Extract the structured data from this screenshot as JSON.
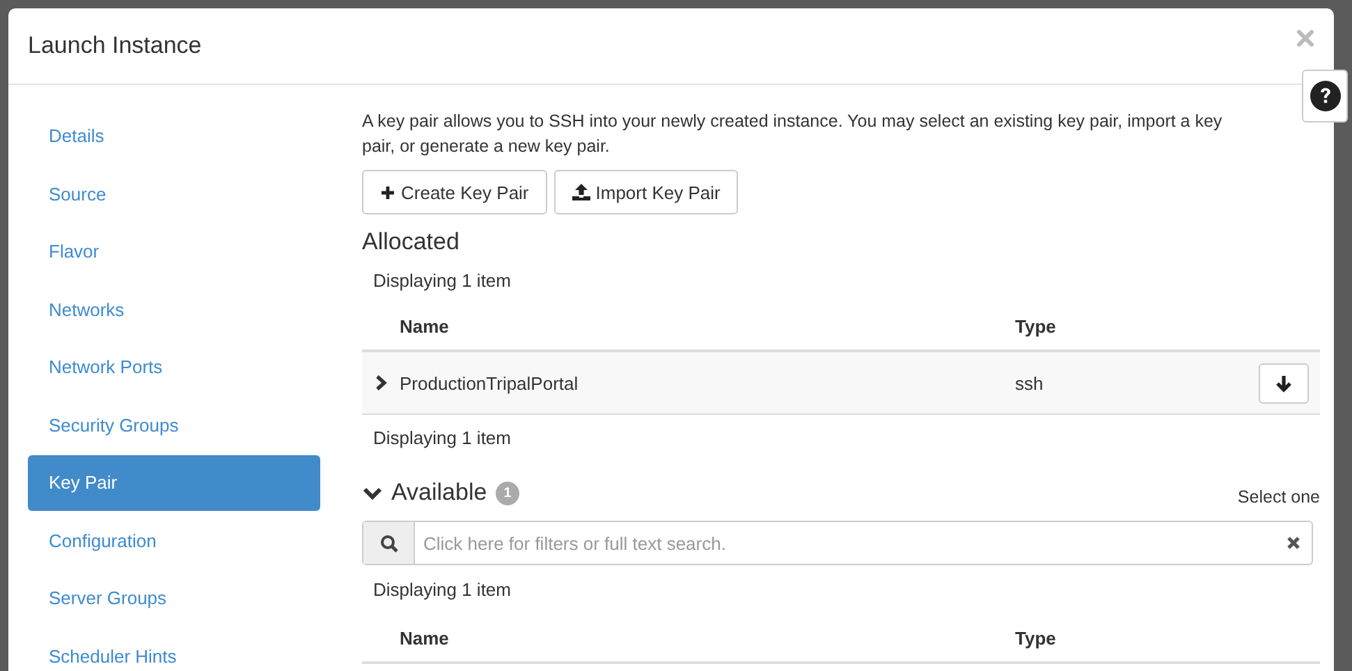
{
  "modal": {
    "title": "Launch Instance"
  },
  "sidebar": {
    "items": [
      {
        "label": "Details",
        "selected": false
      },
      {
        "label": "Source",
        "selected": false
      },
      {
        "label": "Flavor",
        "selected": false
      },
      {
        "label": "Networks",
        "selected": false
      },
      {
        "label": "Network Ports",
        "selected": false
      },
      {
        "label": "Security Groups",
        "selected": false
      },
      {
        "label": "Key Pair",
        "selected": true
      },
      {
        "label": "Configuration",
        "selected": false
      },
      {
        "label": "Server Groups",
        "selected": false
      },
      {
        "label": "Scheduler Hints",
        "selected": false
      }
    ]
  },
  "content": {
    "description": "A key pair allows you to SSH into your newly created instance. You may select an existing key pair, import a key pair, or generate a new key pair.",
    "buttons": [
      {
        "label": "Create Key Pair",
        "kind": "create"
      },
      {
        "label": "Import Key Pair",
        "kind": "import"
      }
    ],
    "allocated": {
      "title": "Allocated",
      "count_top": "Displaying 1 item",
      "columns": [
        "Name",
        "Type"
      ],
      "rows": [
        {
          "name": "ProductionTripalPortal",
          "type": "ssh",
          "expanded": false
        }
      ],
      "count_bottom": "Displaying 1 item"
    },
    "available": {
      "title": "Available",
      "badge": "1",
      "expanded": true,
      "select_hint": "Select one",
      "search": {
        "placeholder": "Click here for filters or full text search."
      },
      "count_top": "Displaying 1 item",
      "columns": [
        "Name",
        "Type"
      ]
    }
  }
}
